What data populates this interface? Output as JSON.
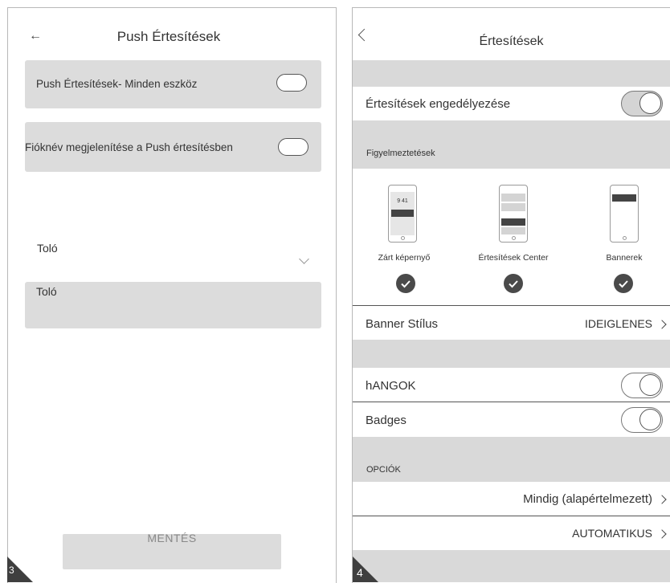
{
  "left_screen": {
    "back_arrow": "←",
    "title": "Push Értesítések",
    "push_all_devices_label": "Push Értesítések- Minden eszköz",
    "show_account_label": "Fióknév megjelenítése a Push értesítésben",
    "slider_label": "Toló",
    "slider_box_label": "Toló",
    "save_label": "MENTÉS",
    "page_number": "3",
    "push_all_devices_on": false,
    "show_account_on": false
  },
  "right_screen": {
    "back_chevron": "<",
    "title": "Értesítések",
    "enable_label": "Értesítések engedélyezése",
    "alerts_section": "Figyelmeztetések",
    "lock_screen_time": "9 41",
    "alert_options": [
      {
        "label": "Zárt képernyő",
        "checked": true
      },
      {
        "label": "Értesítések  Center",
        "checked": true
      },
      {
        "label": "Bannerek",
        "checked": true
      }
    ],
    "banner_style_label": "Banner Stílus",
    "banner_style_value": "IDEIGLENES",
    "sounds_label": "hANGOK",
    "badges_label": "Badges",
    "options_section": "OPCIÓK",
    "preview_value": "Mindig (alapértelmezett)",
    "grouping_value": "AUTOMATIKUS",
    "page_number": "4",
    "enable_on": true,
    "sounds_on": true,
    "badges_on": true
  },
  "colors": {
    "panel_gray": "#d9d9d9",
    "card_gray": "#dcdcdc",
    "corner_dark": "#3f3f3f"
  }
}
